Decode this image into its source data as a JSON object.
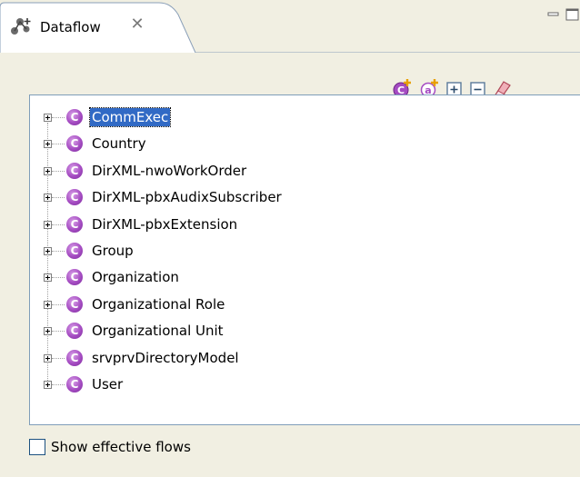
{
  "tab": {
    "title": "Dataflow",
    "icon": "dataflow-icon",
    "close_glyph": "✕"
  },
  "view_controls": [
    "minimize-icon",
    "maximize-icon"
  ],
  "toolbar": {
    "buttons": [
      {
        "name": "add-class-button",
        "icon": "class-add-icon"
      },
      {
        "name": "add-attribute-button",
        "icon": "attribute-add-icon"
      },
      {
        "name": "expand-all-button",
        "icon": "expand-all-icon"
      },
      {
        "name": "collapse-all-button",
        "icon": "collapse-all-icon"
      },
      {
        "name": "clear-button",
        "icon": "eraser-icon"
      }
    ]
  },
  "tree": {
    "icon_glyph": "C",
    "items": [
      {
        "label": "CommExec",
        "selected": true
      },
      {
        "label": "Country",
        "selected": false
      },
      {
        "label": "DirXML-nwoWorkOrder",
        "selected": false
      },
      {
        "label": "DirXML-pbxAudixSubscriber",
        "selected": false
      },
      {
        "label": "DirXML-pbxExtension",
        "selected": false
      },
      {
        "label": "Group",
        "selected": false
      },
      {
        "label": "Organization",
        "selected": false
      },
      {
        "label": "Organizational Role",
        "selected": false
      },
      {
        "label": "Organizational Unit",
        "selected": false
      },
      {
        "label": "srvprvDirectoryModel",
        "selected": false
      },
      {
        "label": "User",
        "selected": false
      }
    ]
  },
  "options": {
    "show_effective_flows_label": "Show effective flows",
    "show_effective_flows_checked": false
  },
  "colors": {
    "selection": "#316ac5",
    "class_icon": "#a54cc2",
    "background": "#f1efe2"
  }
}
